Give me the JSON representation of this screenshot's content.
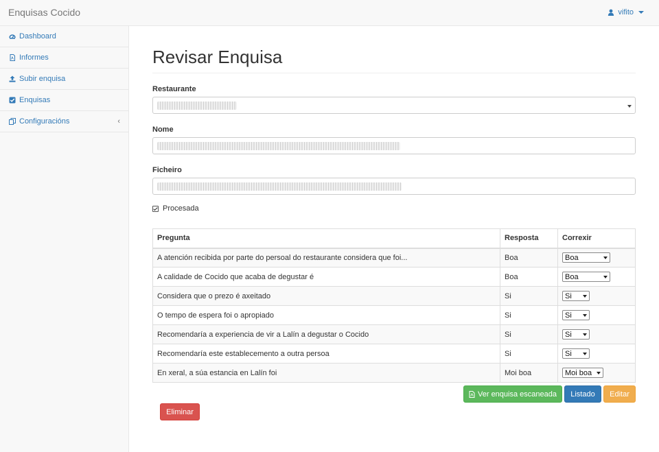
{
  "app": {
    "brand": "Enquisas Cocido",
    "user": "vifito"
  },
  "sidebar": {
    "items": [
      {
        "label": "Dashboard",
        "icon": "dashboard-icon"
      },
      {
        "label": "Informes",
        "icon": "file-pdf-icon"
      },
      {
        "label": "Subir enquisa",
        "icon": "upload-icon"
      },
      {
        "label": "Enquisas",
        "icon": "check-square-icon"
      },
      {
        "label": "Configuracións",
        "icon": "copy-icon",
        "chevron": "‹"
      }
    ]
  },
  "page": {
    "title": "Revisar Enquisa",
    "restaurante_label": "Restaurante",
    "nome_label": "Nome",
    "ficheiro_label": "Ficheiro",
    "procesada_label": "Procesada",
    "procesada_checked": true
  },
  "table": {
    "headers": [
      "Pregunta",
      "Resposta",
      "Correxir"
    ],
    "rows": [
      {
        "pregunta": "A atención recibida por parte do persoal do restaurante considera que foi...",
        "resposta": "Boa",
        "correxir": "Boa"
      },
      {
        "pregunta": "A calidade de Cocido que acaba de degustar é",
        "resposta": "Boa",
        "correxir": "Boa"
      },
      {
        "pregunta": "Considera que o prezo é axeitado",
        "resposta": "Si",
        "correxir": "Si"
      },
      {
        "pregunta": "O tempo de espera foi o apropiado",
        "resposta": "Si",
        "correxir": "Si"
      },
      {
        "pregunta": "Recomendaría a experiencia de vir a Lalín a degustar o Cocido",
        "resposta": "Si",
        "correxir": "Si"
      },
      {
        "pregunta": "Recomendaría este establecemento a outra persoa",
        "resposta": "Si",
        "correxir": "Si"
      },
      {
        "pregunta": "En xeral, a súa estancia en Lalín foi",
        "resposta": "Moi boa",
        "correxir": "Moi boa"
      }
    ]
  },
  "buttons": {
    "ver": "Ver enquisa escaneada",
    "listado": "Listado",
    "editar": "Editar",
    "eliminar": "Eliminar"
  },
  "colors": {
    "link": "#337ab7",
    "success": "#5cb85c",
    "primary": "#337ab7",
    "warning": "#f0ad4e",
    "danger": "#d9534f"
  }
}
